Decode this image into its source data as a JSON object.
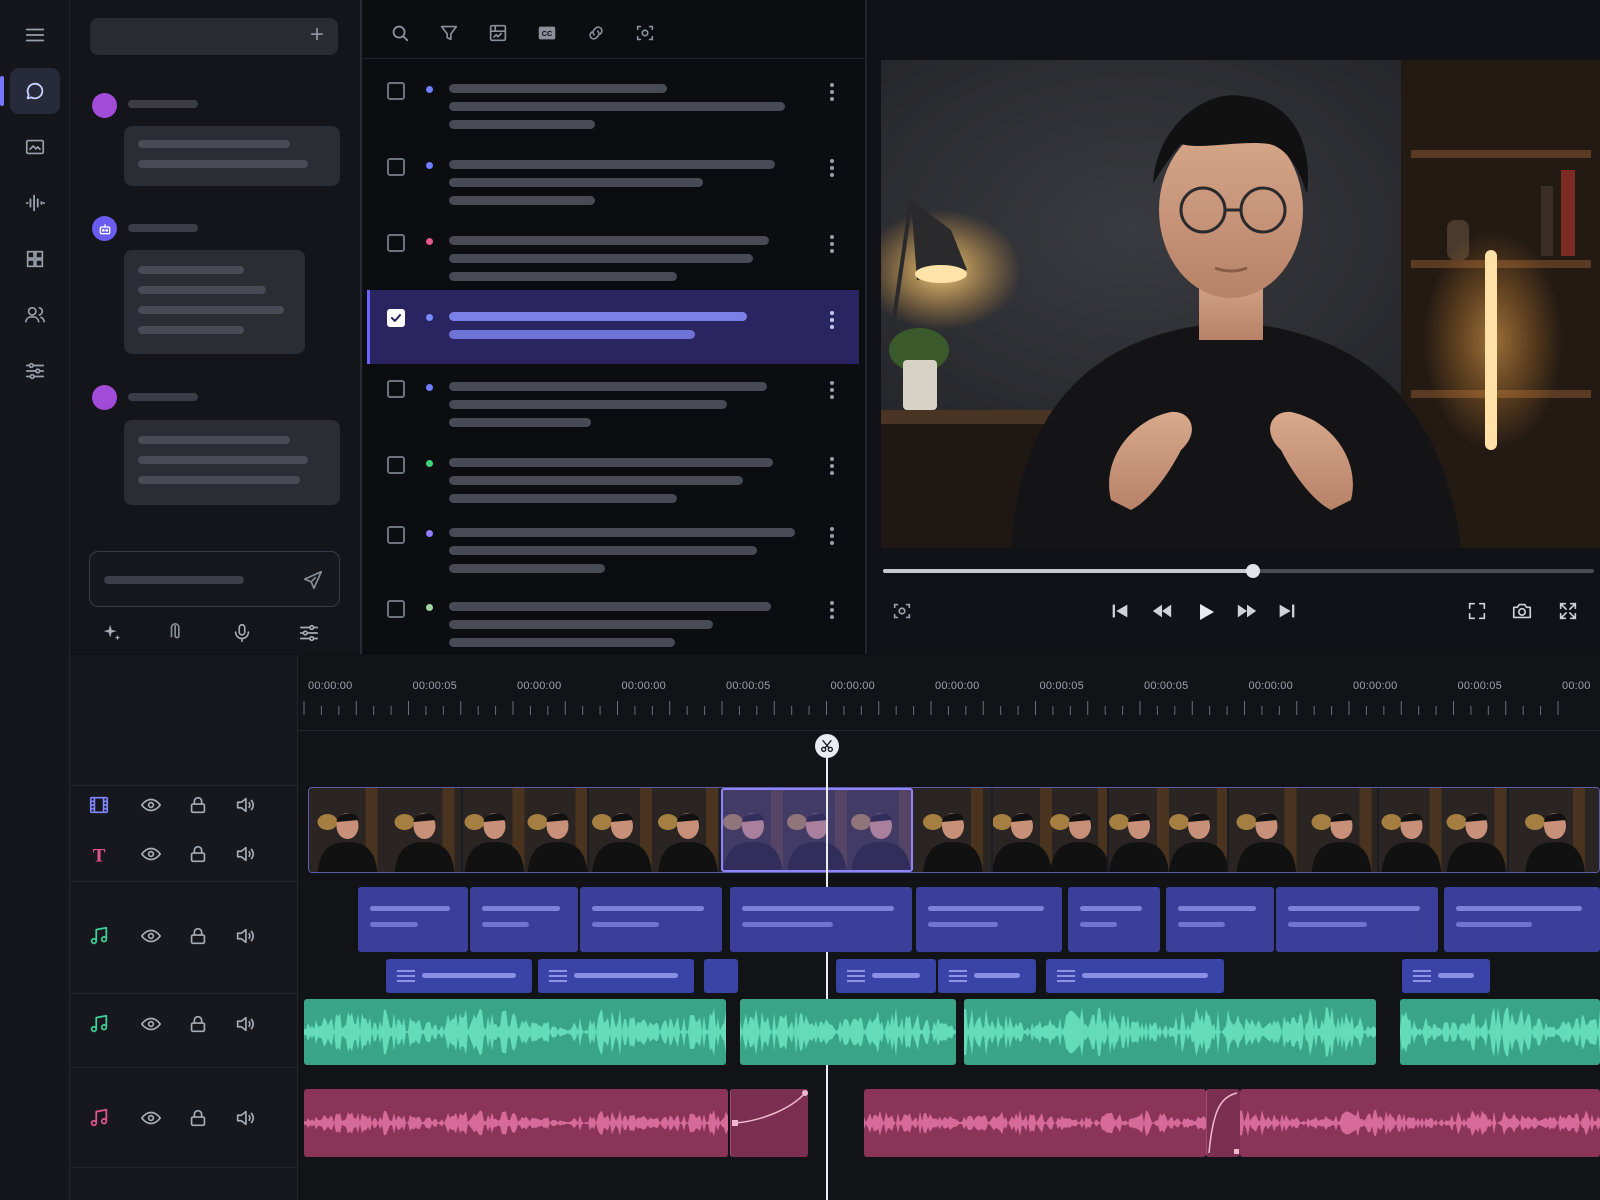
{
  "icons": {
    "rail": [
      "menu-icon",
      "chat-icon",
      "image-icon",
      "audio-waveform-icon",
      "grid-icon",
      "users-icon",
      "sliders-icon"
    ],
    "list_toolbar": [
      "search-icon",
      "filter-icon",
      "media-icon",
      "captions-icon",
      "link-icon",
      "scan-icon"
    ],
    "chat_composer": [
      "sparkle-icon",
      "attachment-icon",
      "microphone-icon",
      "settings-sliders-icon",
      "send-icon"
    ]
  },
  "chat": {
    "new_button": "+",
    "messages": [
      {
        "role": "user",
        "color": "#a24bd8"
      },
      {
        "role": "assistant",
        "color": "#6a5cf0"
      },
      {
        "role": "user",
        "color": "#a24bd8"
      }
    ]
  },
  "list": {
    "items": [
      {
        "checked": false,
        "dot": "#6f7dff"
      },
      {
        "checked": false,
        "dot": "#6f7dff"
      },
      {
        "checked": false,
        "dot": "#e4578b"
      },
      {
        "checked": true,
        "dot": "#7a8dff"
      },
      {
        "checked": false,
        "dot": "#6f7dff"
      },
      {
        "checked": false,
        "dot": "#3ed37a"
      },
      {
        "checked": false,
        "dot": "#8f7dff"
      },
      {
        "checked": false,
        "dot": "#9fd6a0"
      }
    ],
    "selected_index": 3
  },
  "player": {
    "progress": 0.52,
    "controls": [
      "skip-back-icon",
      "rewind-icon",
      "play-icon",
      "fast-forward-icon",
      "skip-forward-icon"
    ],
    "right_controls": [
      "fit-icon",
      "snapshot-icon",
      "fullscreen-icon"
    ],
    "left_control": "scan-icon"
  },
  "timeline": {
    "ruler_labels": [
      "00:00:00",
      "00:00:05",
      "00:00:00",
      "00:00:00",
      "00:00:05",
      "00:00:00",
      "00:00:00",
      "00:00:05",
      "00:00:05",
      "00:00:00",
      "00:00:00",
      "00:00:05",
      "00:00"
    ],
    "playhead_icon": "scissors-icon",
    "tracks": [
      {
        "type": "video",
        "icon": "film-icon",
        "color": "#7f86ff"
      },
      {
        "type": "text",
        "icon": "text-icon",
        "color": "#e05590"
      },
      {
        "type": "music",
        "icon": "music-note-icon",
        "color": "#3fcf95"
      },
      {
        "type": "music",
        "icon": "music-note-icon",
        "color": "#3fcf95"
      },
      {
        "type": "music",
        "icon": "music-note-icon",
        "color": "#e05590"
      }
    ],
    "track_controls": [
      "eye-icon",
      "lock-icon",
      "volume-icon"
    ],
    "colors": {
      "caption": "#3b3f9a",
      "caption_small": "#3a44a6",
      "green_audio": "#3aa586",
      "pink_audio": "#8a3458",
      "selected_clip": "#8f86ff"
    }
  }
}
